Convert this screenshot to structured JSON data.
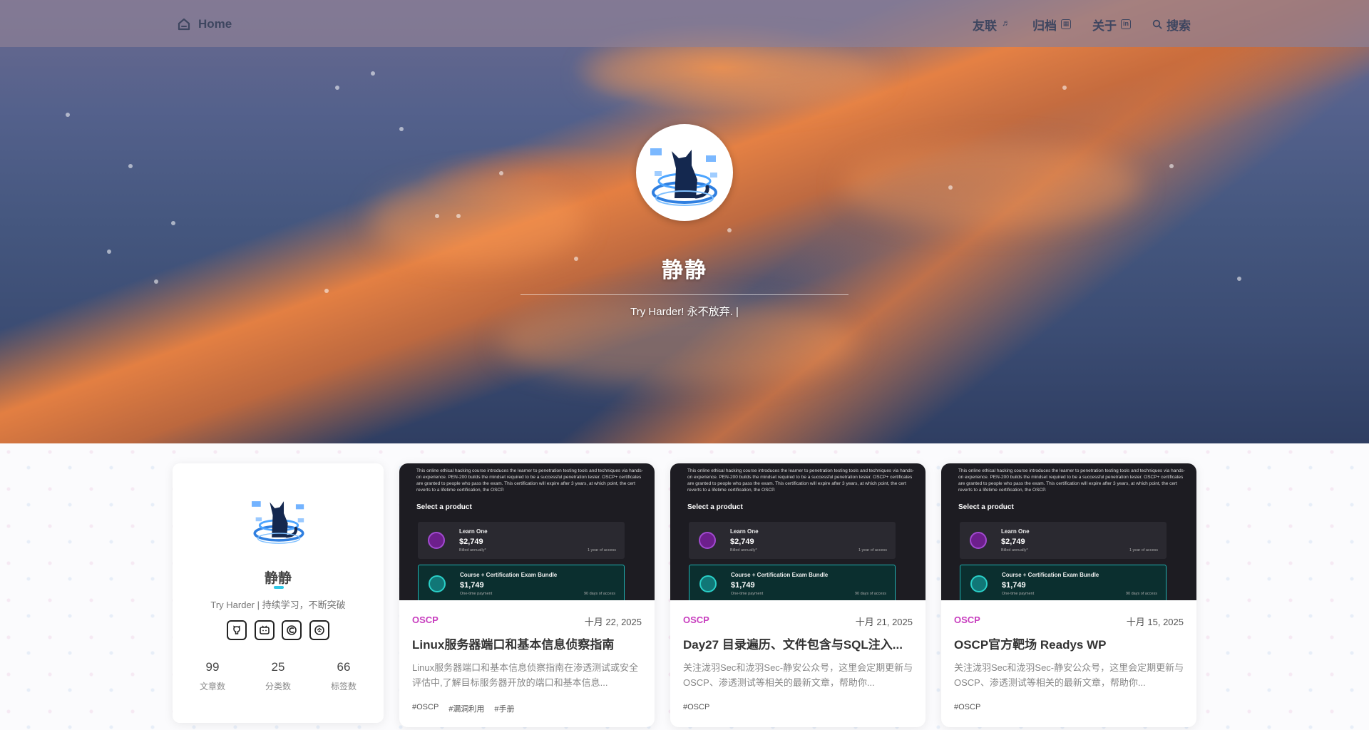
{
  "nav": {
    "home_label": "Home",
    "items": [
      {
        "label": "友联",
        "icon": "friends-icon"
      },
      {
        "label": "归档",
        "icon": "archive-icon"
      },
      {
        "label": "关于",
        "icon": "about-icon"
      },
      {
        "label": "搜索",
        "icon": "search-icon"
      }
    ]
  },
  "hero": {
    "title": "静静",
    "subtitle": "Try Harder! 永不放弃. |"
  },
  "profile": {
    "name": "静静",
    "bio": "Try Harder | 持续学习，不断突破",
    "social": [
      "github-icon",
      "bilibili-icon",
      "csdn-icon",
      "juejin-icon"
    ],
    "stats": [
      {
        "num": "99",
        "label": "文章数"
      },
      {
        "num": "25",
        "label": "分类数"
      },
      {
        "num": "66",
        "label": "标签数"
      }
    ]
  },
  "thumb": {
    "paragraph": "This online ethical hacking course introduces the learner to penetration testing tools and techniques via hands-on experience. PEN-200 builds the mindset required to be a successful penetration tester. OSCP+ certificates are granted to people who pass the exam. This certification will expire after 3 years, at which point, the cert reverts to a lifetime certification, the OSCP.",
    "select_label": "Select a product",
    "product1": {
      "name": "Learn One",
      "price": "$2,749",
      "note": "Billed annually*",
      "access": "1 year of access"
    },
    "product2": {
      "name": "Course + Certification Exam Bundle",
      "price": "$1,749",
      "note": "One-time payment",
      "access": "90 days of access"
    }
  },
  "posts": [
    {
      "category": "OSCP",
      "date": "十月 22, 2025",
      "title": "Linux服务器端口和基本信息侦察指南",
      "excerpt": "Linux服务器端口和基本信息侦察指南在渗透测试或安全评估中,了解目标服务器开放的端口和基本信息...",
      "tags": [
        "#OSCP",
        "#漏洞利用",
        "#手册"
      ]
    },
    {
      "category": "OSCP",
      "date": "十月 21, 2025",
      "title": "Day27 目录遍历、文件包含与SQL注入...",
      "excerpt": "关注泷羽Sec和泷羽Sec-静安公众号，这里会定期更新与OSCP、渗透测试等相关的最新文章，帮助你...",
      "tags": [
        "#OSCP"
      ]
    },
    {
      "category": "OSCP",
      "date": "十月 15, 2025",
      "title": "OSCP官方靶场 Readys WP",
      "excerpt": "关注泷羽Sec和泷羽Sec-静安公众号，这里会定期更新与OSCP、渗透测试等相关的最新文章，帮助你...",
      "tags": [
        "#OSCP"
      ]
    }
  ],
  "colors": {
    "accent": "#2ec7e6",
    "category": "#c83fbf",
    "nav_text": "#3e4660"
  }
}
